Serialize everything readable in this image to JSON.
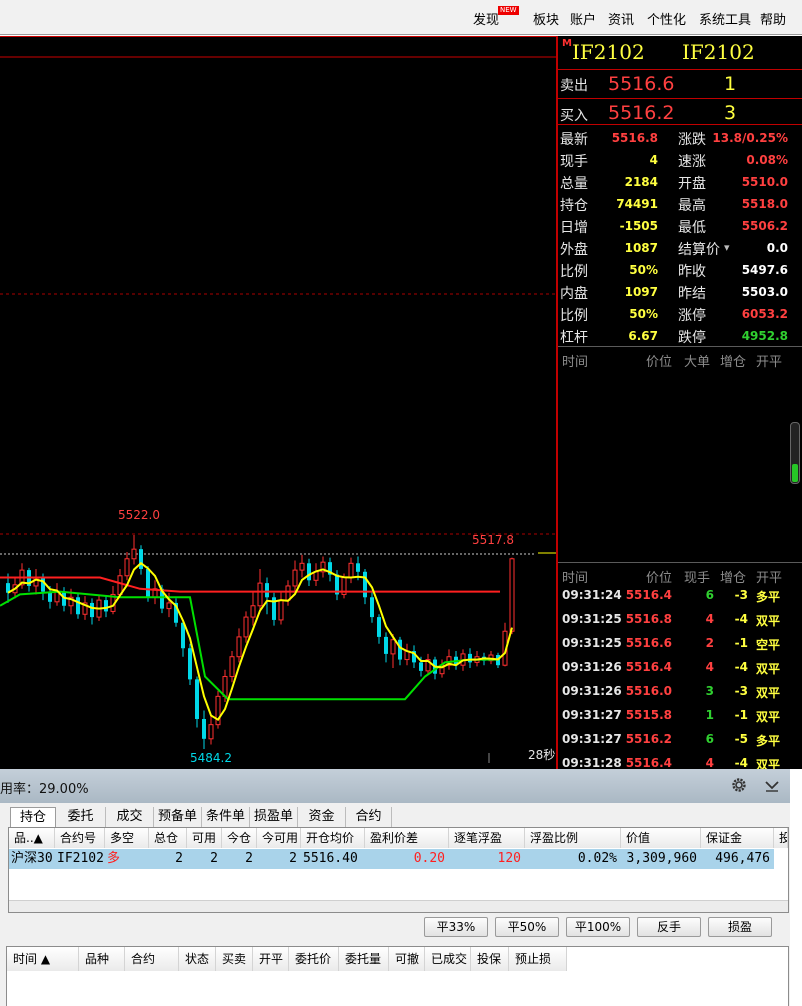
{
  "menu": {
    "items": [
      "发现",
      "板块",
      "账户",
      "资讯",
      "个性化",
      "系统工具",
      "帮助"
    ],
    "new_badge": "NEW"
  },
  "chart": {
    "high_label": "5522.0",
    "low_label": "5484.2",
    "last_label": "5517.8",
    "countdown": "28秒",
    "colors": {
      "up": "#ff3030",
      "down": "#00d8e8",
      "ma_fast": "#ffff00",
      "ma_slow": "#00e000",
      "ref_line": "#ff2020"
    }
  },
  "quote": {
    "marker": "M",
    "code": "IF2102",
    "code_name": "IF2102",
    "sell_label": "卖出",
    "sell_price": "5516.6",
    "sell_vol": "1",
    "buy_label": "买入",
    "buy_price": "5516.2",
    "buy_vol": "3",
    "left": [
      {
        "label": "最新",
        "value": "5516.8",
        "color": "#ff4040"
      },
      {
        "label": "现手",
        "value": "4",
        "color": "#ffff40"
      },
      {
        "label": "总量",
        "value": "2184",
        "color": "#ffff40"
      },
      {
        "label": "持仓",
        "value": "74491",
        "color": "#ffff40"
      },
      {
        "label": "日增",
        "value": "-1505",
        "color": "#ffff40"
      },
      {
        "label": "外盘",
        "value": "1087",
        "color": "#ffff40"
      },
      {
        "label": "比例",
        "value": "50%",
        "color": "#ffff40"
      },
      {
        "label": "内盘",
        "value": "1097",
        "color": "#ffff40"
      },
      {
        "label": "比例",
        "value": "50%",
        "color": "#ffff40"
      },
      {
        "label": "杠杆",
        "value": "6.67",
        "color": "#ffff40"
      }
    ],
    "right": [
      {
        "label": "涨跌",
        "value": "13.8/0.25%",
        "color": "#ff4040"
      },
      {
        "label": "速涨",
        "value": "0.08%",
        "color": "#ff4040"
      },
      {
        "label": "开盘",
        "value": "5510.0",
        "color": "#ff4040"
      },
      {
        "label": "最高",
        "value": "5518.0",
        "color": "#ff4040"
      },
      {
        "label": "最低",
        "value": "5506.2",
        "color": "#ff4040"
      },
      {
        "label": "结算价",
        "value": "0.0",
        "color": "#ffffff"
      },
      {
        "label": "昨收",
        "value": "5497.6",
        "color": "#ffffff"
      },
      {
        "label": "昨结",
        "value": "5503.0",
        "color": "#ffffff"
      },
      {
        "label": "涨停",
        "value": "6053.2",
        "color": "#ff4040"
      },
      {
        "label": "跌停",
        "value": "4952.8",
        "color": "#30d030"
      }
    ],
    "big_header": {
      "time": "时间",
      "price": "价位",
      "big": "大单",
      "oi": "增仓",
      "type": "开平"
    },
    "ticks_header": {
      "time": "时间",
      "price": "价位",
      "vol": "现手",
      "oi": "增仓",
      "type": "开平"
    },
    "ticks": [
      {
        "time": "09:31:24",
        "price": "5516.4",
        "vol": "6",
        "vol_color": "#30d030",
        "oi": "-3",
        "type": "多平",
        "type_color": "#ffff40"
      },
      {
        "time": "09:31:25",
        "price": "5516.8",
        "vol": "4",
        "vol_color": "#ff4040",
        "oi": "-4",
        "type": "双平",
        "type_color": "#ffff40"
      },
      {
        "time": "09:31:25",
        "price": "5516.6",
        "vol": "2",
        "vol_color": "#ff4040",
        "oi": "-1",
        "type": "空平",
        "type_color": "#ffff40"
      },
      {
        "time": "09:31:26",
        "price": "5516.4",
        "vol": "4",
        "vol_color": "#ff4040",
        "oi": "-4",
        "type": "双平",
        "type_color": "#ffff40"
      },
      {
        "time": "09:31:26",
        "price": "5516.0",
        "vol": "3",
        "vol_color": "#30d030",
        "oi": "-3",
        "type": "双平",
        "type_color": "#ffff40"
      },
      {
        "time": "09:31:27",
        "price": "5515.8",
        "vol": "1",
        "vol_color": "#30d030",
        "oi": "-1",
        "type": "双平",
        "type_color": "#ffff40"
      },
      {
        "time": "09:31:27",
        "price": "5516.2",
        "vol": "6",
        "vol_color": "#30d030",
        "oi": "-5",
        "type": "多平",
        "type_color": "#ffff40"
      },
      {
        "time": "09:31:28",
        "price": "5516.4",
        "vol": "4",
        "vol_color": "#ff4040",
        "oi": "-4",
        "type": "双平",
        "type_color": "#ffff40"
      }
    ]
  },
  "account": {
    "ratio_text": "用率：29.00%"
  },
  "tabs": [
    "持仓",
    "委托",
    "成交",
    "预备单",
    "条件单",
    "损盈单",
    "资金",
    "合约"
  ],
  "positions": {
    "columns": [
      "品..▲",
      "合约号",
      "多空",
      "总仓",
      "可用",
      "今仓",
      "今可用",
      "开仓均价",
      "盈利价差",
      "逐笔浮盈",
      "浮盈比例",
      "价值",
      "保证金",
      "投"
    ],
    "rows": [
      {
        "product": "沪深30",
        "contract": "IF2102",
        "side": "多",
        "total": "2",
        "avail": "2",
        "today": "2",
        "today_avail": "2",
        "avg_price": "5516.40",
        "spread": "0.20",
        "float_pnl": "120",
        "pnl_ratio": "0.02%",
        "value": "3,309,960",
        "margin": "496,476"
      }
    ]
  },
  "actions": [
    "平33%",
    "平50%",
    "平100%",
    "反手",
    "损盈"
  ],
  "orders": {
    "columns": [
      "时间 ▲",
      "品种",
      "合约",
      "状态",
      "买卖",
      "开平",
      "委托价",
      "委托量",
      "可撤",
      "已成交",
      "投保",
      "预止损"
    ]
  }
}
